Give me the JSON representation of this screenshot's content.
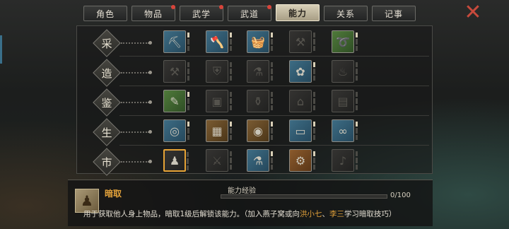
{
  "tabs": [
    {
      "label": "角色",
      "active": false,
      "dot": false
    },
    {
      "label": "物品",
      "active": false,
      "dot": true
    },
    {
      "label": "武学",
      "active": false,
      "dot": true
    },
    {
      "label": "武道",
      "active": false,
      "dot": true
    },
    {
      "label": "能力",
      "active": true,
      "dot": false
    },
    {
      "label": "关系",
      "active": false,
      "dot": false
    },
    {
      "label": "记事",
      "active": false,
      "dot": false
    }
  ],
  "rows": [
    {
      "label": "采",
      "cells": [
        {
          "icon": "shovel-icon",
          "glyph": "⛏",
          "bg": "bg-blue",
          "lit": true,
          "level": 1
        },
        {
          "icon": "axe-icon",
          "glyph": "🪓",
          "bg": "bg-blue",
          "lit": true,
          "level": 1
        },
        {
          "icon": "basket-icon",
          "glyph": "🧺",
          "bg": "bg-blue",
          "lit": true,
          "level": 1
        },
        {
          "icon": "sickle-icon",
          "glyph": "⚒",
          "bg": "bg-dark",
          "lit": false,
          "level": 0
        },
        {
          "icon": "rope-coil-icon",
          "glyph": "➰",
          "bg": "bg-green",
          "lit": true,
          "level": 1
        }
      ]
    },
    {
      "label": "造",
      "cells": [
        {
          "icon": "anvil-icon",
          "glyph": "⚒",
          "bg": "bg-dark",
          "lit": false,
          "level": 0
        },
        {
          "icon": "armor-icon",
          "glyph": "⛨",
          "bg": "bg-dark",
          "lit": false,
          "level": 0
        },
        {
          "icon": "cauldron-icon",
          "glyph": "⚗",
          "bg": "bg-dark",
          "lit": false,
          "level": 0
        },
        {
          "icon": "medicine-herb-icon",
          "glyph": "✿",
          "bg": "bg-blue",
          "lit": true,
          "level": 1
        },
        {
          "icon": "furnace-icon",
          "glyph": "♨",
          "bg": "bg-dark",
          "lit": false,
          "level": 0
        }
      ]
    },
    {
      "label": "鉴",
      "cells": [
        {
          "icon": "scroll-appraise-icon",
          "glyph": "✎",
          "bg": "bg-green",
          "lit": true,
          "level": 1
        },
        {
          "icon": "cloth-icon",
          "glyph": "▣",
          "bg": "bg-dark",
          "lit": false,
          "level": 0
        },
        {
          "icon": "pot-icon",
          "glyph": "⚱",
          "bg": "bg-dark",
          "lit": false,
          "level": 0
        },
        {
          "icon": "hat-icon",
          "glyph": "⌂",
          "bg": "bg-dark",
          "lit": false,
          "level": 0
        },
        {
          "icon": "book-icon",
          "glyph": "▤",
          "bg": "bg-dark",
          "lit": false,
          "level": 0
        }
      ]
    },
    {
      "label": "生",
      "cells": [
        {
          "icon": "food-plate-icon",
          "glyph": "◎",
          "bg": "bg-blue",
          "lit": true,
          "level": 1
        },
        {
          "icon": "chocolate-block-icon",
          "glyph": "▦",
          "bg": "bg-brown",
          "lit": true,
          "level": 1
        },
        {
          "icon": "round-box-icon",
          "glyph": "◉",
          "bg": "bg-brown",
          "lit": true,
          "level": 1
        },
        {
          "icon": "map-paper-icon",
          "glyph": "▭",
          "bg": "bg-blue",
          "lit": true,
          "level": 1
        },
        {
          "icon": "whip-coil-icon",
          "glyph": "∞",
          "bg": "bg-blue",
          "lit": true,
          "level": 1
        }
      ]
    },
    {
      "label": "市",
      "cells": [
        {
          "icon": "money-pouch-icon",
          "glyph": "♟",
          "bg": "bg-dark",
          "lit": true,
          "level": 0,
          "selected": true
        },
        {
          "icon": "cleaver-icon",
          "glyph": "⚔",
          "bg": "bg-dark",
          "lit": false,
          "level": 0
        },
        {
          "icon": "bottle-icon",
          "glyph": "⚗",
          "bg": "bg-blue",
          "lit": true,
          "level": 1
        },
        {
          "icon": "gears-icon",
          "glyph": "⚙",
          "bg": "bg-orange",
          "lit": true,
          "level": 1
        },
        {
          "icon": "flute-icon",
          "glyph": "♪",
          "bg": "bg-dark",
          "lit": false,
          "level": 0
        }
      ]
    }
  ],
  "info": {
    "skill_icon": "money-pouch-icon",
    "skill_icon_glyph": "♟",
    "skill_name": "暗取",
    "exp_label": "能力经验",
    "exp_value": "0/100",
    "exp_progress": 0.0,
    "desc_main": "用于获取他人身上物品，暗取1级后解锁该能力。（加入燕子窝或向",
    "desc_name1": "洪小七",
    "desc_sep": "、",
    "desc_name2": "李三",
    "desc_tail": "学习暗取技巧）"
  },
  "close_label": "✕",
  "colors": {
    "accent": "#e2a13a",
    "close": "#c84a3c"
  }
}
